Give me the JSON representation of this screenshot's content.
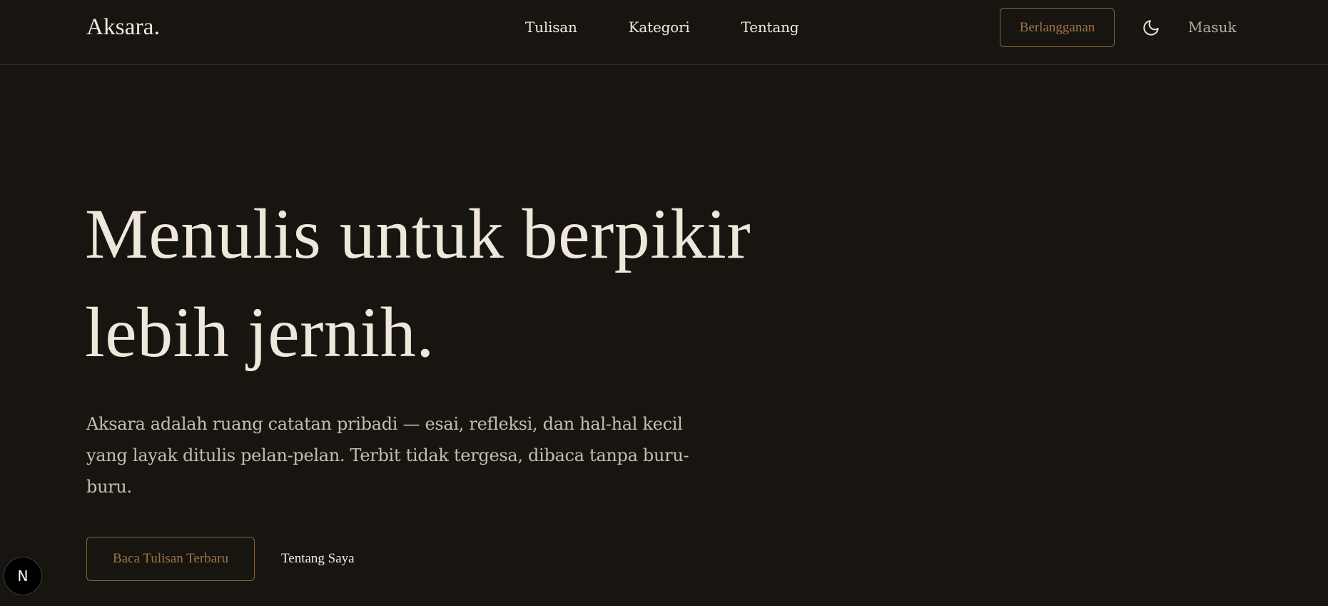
{
  "header": {
    "brand": "Aksara.",
    "nav": [
      {
        "label": "Tulisan"
      },
      {
        "label": "Kategori"
      },
      {
        "label": "Tentang"
      }
    ],
    "subscribe_label": "Berlangganan",
    "theme_icon": "moon-icon",
    "login_label": "Masuk"
  },
  "hero": {
    "title_line1": "Menulis untuk berpikir",
    "title_line2": "lebih jernih.",
    "description": "Aksara adalah ruang catatan pribadi — esai, refleksi, dan hal-hal kecil yang layak ditulis pelan-pelan. Terbit tidak tergesa, dibaca tanpa buru-buru.",
    "primary_cta": "Baca Tulisan Terbaru",
    "secondary_cta": "Tentang Saya"
  },
  "dev_badge": {
    "letter": "N",
    "icon": "nextjs-icon"
  },
  "colors": {
    "background": "#181511",
    "text": "#efe7da",
    "muted_text": "#c7bdae",
    "accent": "#9d7442",
    "accent_border": "#8a6534",
    "divider": "#2c2822"
  }
}
